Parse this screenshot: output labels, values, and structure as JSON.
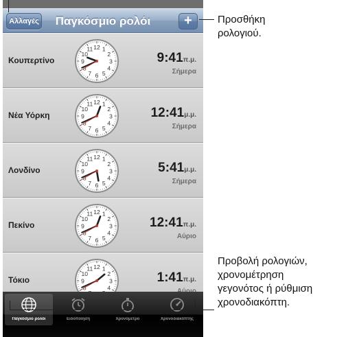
{
  "nav": {
    "edit_label": "Αλλαγές",
    "title": "Παγκόσμιο ρολόι",
    "add_label": "+"
  },
  "clocks": [
    {
      "city": "Κουπερτίνο",
      "time": "9:41",
      "ampm": "π.μ.",
      "day": "Σήμερα",
      "hour": 9,
      "minute": 41,
      "second": 40
    },
    {
      "city": "Νέα Υόρκη",
      "time": "12:41",
      "ampm": "μ.μ.",
      "day": "Σήμερα",
      "hour": 12,
      "minute": 41,
      "second": 40
    },
    {
      "city": "Λονδίνο",
      "time": "5:41",
      "ampm": "μ.μ.",
      "day": "Σήμερα",
      "hour": 5,
      "minute": 41,
      "second": 40
    },
    {
      "city": "Πεκίνο",
      "time": "12:41",
      "ampm": "π.μ.",
      "day": "Αύριο",
      "hour": 12,
      "minute": 41,
      "second": 40
    },
    {
      "city": "Τόκιο",
      "time": "1:41",
      "ampm": "π.μ.",
      "day": "Αύριο",
      "hour": 1,
      "minute": 41,
      "second": 40
    }
  ],
  "tabs": [
    {
      "label": "Παγκόσμιο ρολόι",
      "icon": "globe-icon",
      "active": true
    },
    {
      "label": "Ειδοποίηση",
      "icon": "alarm-clock-icon",
      "active": false
    },
    {
      "label": "Χρονόμετρο",
      "icon": "stopwatch-icon",
      "active": false
    },
    {
      "label": "Χρονοδιακόπτης",
      "icon": "timer-icon",
      "active": false
    }
  ],
  "callouts": {
    "add": [
      "Προσθήκη",
      "ρολογιού."
    ],
    "views": [
      "Προβολή ρολογιών,",
      "χρονομέτρηση",
      "γεγονότος ή ρύθμιση",
      "χρονοδιακόπτη."
    ]
  },
  "colors": {
    "navbar": "#8aa1bd",
    "second_hand": "#c0392b",
    "row": "#d4d4d4",
    "tabbar": "#111111"
  }
}
